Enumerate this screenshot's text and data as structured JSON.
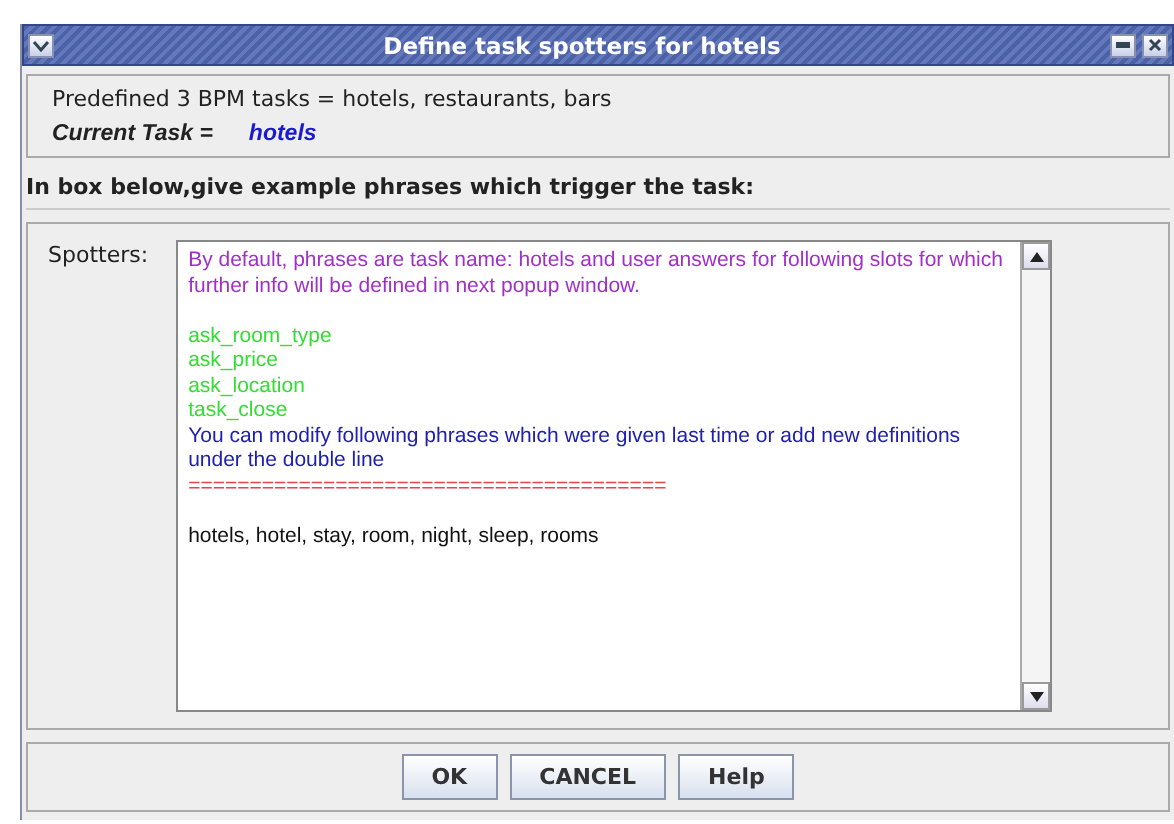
{
  "window": {
    "title": "Define task spotters for hotels"
  },
  "info": {
    "predefined": "Predefined 3 BPM tasks = hotels, restaurants, bars",
    "current_label": "Current Task =",
    "current_value": "hotels"
  },
  "instruction": "In box below,give example phrases which trigger the task:",
  "spotters": {
    "label": "Spotters:",
    "lines": [
      {
        "kind": "intro",
        "text": "By default, phrases are task name: hotels and user answers for following slots for which further info will be defined in next popup window."
      },
      {
        "kind": "blank"
      },
      {
        "kind": "slot",
        "text": "ask_room_type"
      },
      {
        "kind": "slot",
        "text": "ask_price"
      },
      {
        "kind": "slot",
        "text": "ask_location"
      },
      {
        "kind": "slot",
        "text": "task_close"
      },
      {
        "kind": "note",
        "text": "You can modify following phrases which were given last time or add new definitions under the double line"
      },
      {
        "kind": "separator",
        "text": "======================================="
      },
      {
        "kind": "blank"
      },
      {
        "kind": "phrase",
        "text": "hotels, hotel, stay, room, night, sleep, rooms"
      }
    ]
  },
  "buttons": [
    "OK",
    "CANCEL",
    "Help"
  ]
}
